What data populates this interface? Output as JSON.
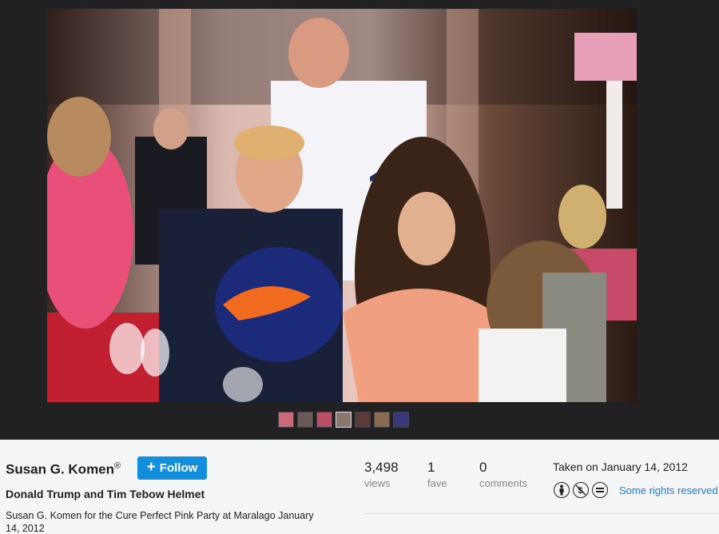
{
  "photo": {
    "icon": "photo-content",
    "thumbnail_colors": [
      "#c86a7a",
      "#6a5a58",
      "#b85068",
      "#8a7870",
      "#5a3a3a",
      "#8a6a50",
      "#3a3a7a"
    ]
  },
  "owner": {
    "name": "Susan G. Komen",
    "reg_mark": "®",
    "follow_label": "Follow"
  },
  "title": "Donald Trump and Tim Tebow Helmet",
  "description": "Susan G. Komen for the Cure Perfect Pink Party at Maralago January 14, 2012",
  "stats": {
    "views": {
      "value": "3,498",
      "label": "views"
    },
    "faves": {
      "value": "1",
      "label": "fave"
    },
    "comments": {
      "value": "0",
      "label": "comments"
    }
  },
  "taken": "Taken on January 14, 2012",
  "license": {
    "icons": [
      "attribution-icon",
      "noncommercial-icon",
      "noderivs-icon"
    ],
    "label": "Some rights reserved"
  },
  "colors": {
    "accent": "#128fdc",
    "link": "#1c7ad9"
  }
}
